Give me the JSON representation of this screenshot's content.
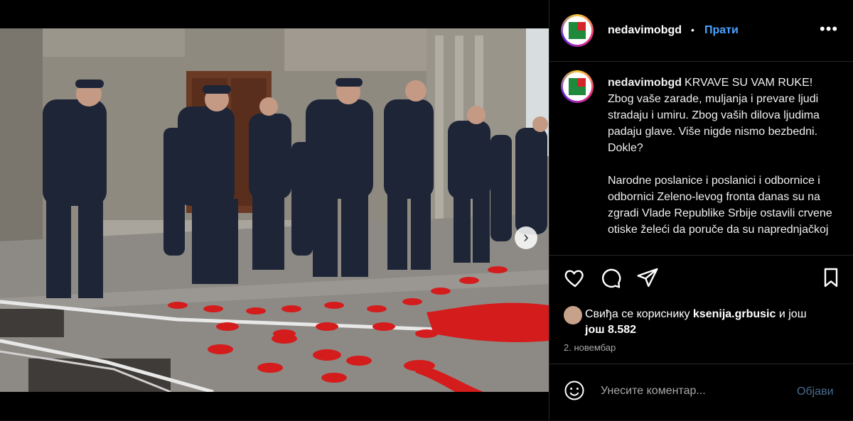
{
  "post": {
    "username": "nedavimobgd",
    "follow_label": "Прати",
    "separator": "•",
    "more_label": "•••",
    "caption_first": "KRVAVE SU VAM RUKE! Zbog vaše zarade, muljanja i prevare ljudi stradaju i umiru. Zbog vaših dilova ljudima padaju glave. Više nigde nismo bezbedni. Dokle?",
    "caption_second": "Narodne poslanice i poslanici i odbornice i odbornici Zeleno-levog fronta danas su na zgradi Vlade Republike Srbije ostavili crvene otiske želeći da poruče da su naprednjačkoj",
    "likes_prefix": "Свиђа се кориснику",
    "likes_user": "ksenija.grbusic",
    "likes_mid": "и још",
    "likes_count": "још 8.582",
    "date": "2. новембар",
    "comment_placeholder": "Унесите коментар...",
    "post_label": "Објави",
    "carousel_next": "›"
  },
  "icons": {
    "heart": "heart-icon",
    "comment": "comment-icon",
    "share": "paper-plane-icon",
    "save": "bookmark-icon",
    "emoji": "emoji-icon",
    "next": "chevron-right-icon"
  },
  "carousel": {
    "slide_count": 6,
    "active_index": 0
  },
  "colors": {
    "accent": "#4aa3ff",
    "background": "#000000",
    "muted": "#a8a8a8",
    "paint": "#d41c1c"
  }
}
